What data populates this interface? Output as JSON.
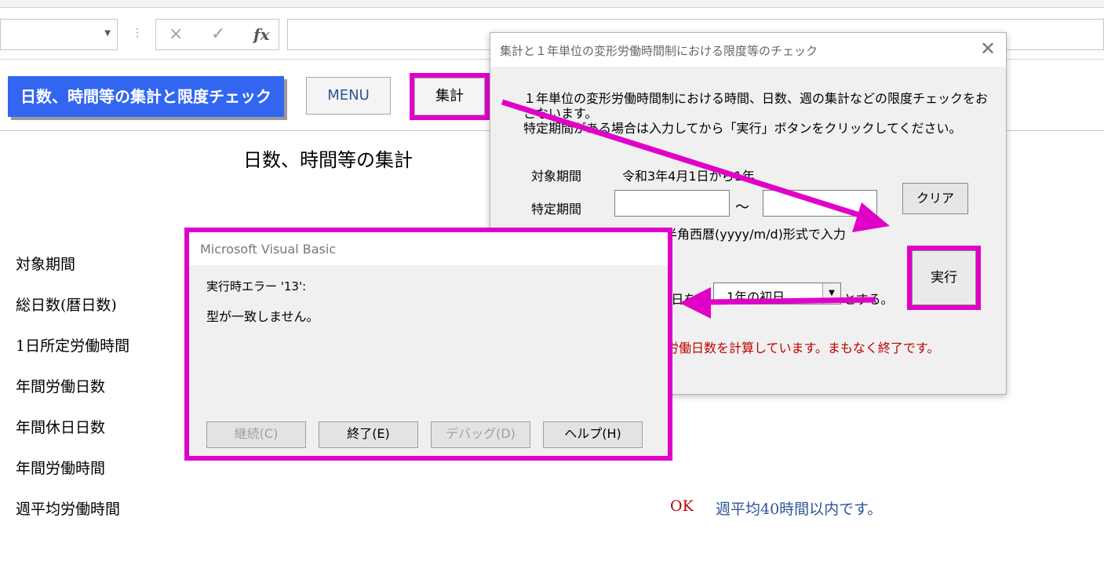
{
  "formula_bar": {
    "name_box_value": "",
    "separator_icon": "more-vertical-icon",
    "cancel_icon": "×",
    "enter_icon": "✓",
    "fx_label": "fx",
    "formula_value": ""
  },
  "sheet": {
    "title_button": "日数、時間等の集計と限度チェック",
    "menu_button": "MENU",
    "tally_button": "集計",
    "heading": "日数、時間等の集計",
    "row_labels": [
      "対象期間",
      "総日数(暦日数)",
      "1日所定労働時間",
      "年間労働日数",
      "年間休日日数",
      "年間労働時間",
      "週平均労働時間"
    ],
    "weekly_result": "OK",
    "weekly_message": "週平均40時間以内です。"
  },
  "userform": {
    "title": "集計と１年単位の変形労働時間制における限度等のチェック",
    "close_icon": "✕",
    "description": "１年単位の変形労働時間制における時間、日数、週の集計などの限度チェックをおこないます。\n特定期間がある場合は入力してから「実行」ボタンをクリックしてください。",
    "period_label": "対象期間",
    "period_value": "令和3年4月1日から1年",
    "specific_label": "特定期間",
    "specific_start": "",
    "specific_end": "",
    "tilde": "～",
    "clear_button": "クリア",
    "format_note": "年月日は半角西暦(yyyy/m/d)形式で入力",
    "execute_button": "実行",
    "basis_prefix": ")日を",
    "basis_select": "1年の初日",
    "basis_suffix": "とする。",
    "status_message": "労働日数を計算しています。まもなく終了です。"
  },
  "vb_dialog": {
    "title": "Microsoft Visual Basic",
    "error_line1": "実行時エラー '13':",
    "error_line2": "型が一致しません。",
    "buttons": {
      "continue": "継続(C)",
      "end": "終了(E)",
      "debug": "デバッグ(D)",
      "help": "ヘルプ(H)"
    }
  },
  "colors": {
    "highlight": "#e000c8",
    "title_button_bg": "#3266f0",
    "error_red": "#c00000",
    "link_blue": "#2f5597"
  }
}
